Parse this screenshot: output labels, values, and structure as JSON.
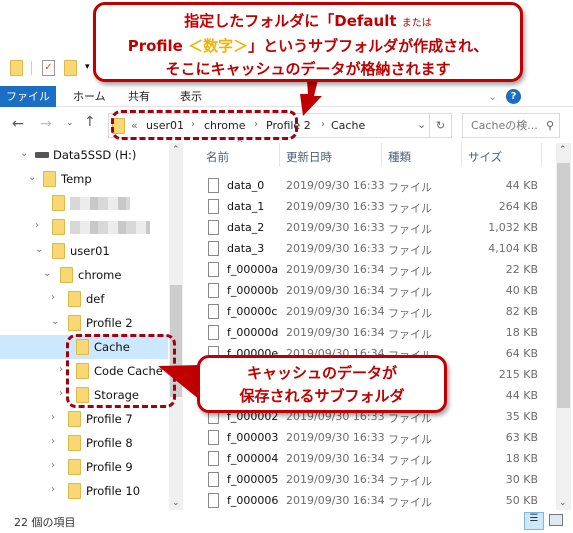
{
  "callouts": {
    "top_line1": "指定したフォルダに「Default",
    "top_line1_small": "または",
    "top_line2_a": "Profile",
    "top_line2_highlight": "＜数字＞",
    "top_line2_b": "」というサブフォルダが作成され、",
    "top_line3": "そこにキャッシュのデータが格納されます",
    "side_line1": "キャッシュのデータが",
    "side_line2": "保存されるサブフォルダ"
  },
  "colors": {
    "accent_red": "#c00000",
    "highlight_yellow": "#f0b400",
    "file_tab_blue": "#1a6fc5",
    "selection": "#cce8ff"
  },
  "ribbon": {
    "tabs": [
      "ファイル",
      "ホーム",
      "共有",
      "表示"
    ]
  },
  "address": {
    "overflow": "«",
    "crumbs": [
      "user01",
      "chrome",
      "Profile 2",
      "Cache"
    ],
    "search_placeholder": "Cacheの検..."
  },
  "tree": [
    {
      "label": "Data5SSD (H:)",
      "level": 0,
      "expanded": true,
      "icon": "drive-icon"
    },
    {
      "label": "Temp",
      "level": 1,
      "expanded": true
    },
    {
      "label": "",
      "level": 2,
      "blurred": true,
      "leaf": true
    },
    {
      "label": "",
      "level": 2,
      "blurred": true
    },
    {
      "label": "user01",
      "level": 2,
      "expanded": true
    },
    {
      "label": "chrome",
      "level": 3,
      "expanded": true
    },
    {
      "label": "def",
      "level": 4
    },
    {
      "label": "Profile 2",
      "level": 4,
      "expanded": true
    },
    {
      "label": "Cache",
      "level": 5,
      "selected": true,
      "leaf": true
    },
    {
      "label": "Code Cache",
      "level": 5
    },
    {
      "label": "Storage",
      "level": 5
    },
    {
      "label": "Profile 7",
      "level": 4
    },
    {
      "label": "Profile 8",
      "level": 4
    },
    {
      "label": "Profile 9",
      "level": 4
    },
    {
      "label": "Profile 10",
      "level": 4
    }
  ],
  "columns": [
    "名前",
    "更新日時",
    "種類",
    "サイズ"
  ],
  "files": [
    {
      "name": "data_0",
      "date": "2019/09/30 16:33",
      "type": "ファイル",
      "size": "44 KB"
    },
    {
      "name": "data_1",
      "date": "2019/09/30 16:33",
      "type": "ファイル",
      "size": "264 KB"
    },
    {
      "name": "data_2",
      "date": "2019/09/30 16:33",
      "type": "ファイル",
      "size": "1,032 KB"
    },
    {
      "name": "data_3",
      "date": "2019/09/30 16:33",
      "type": "ファイル",
      "size": "4,104 KB"
    },
    {
      "name": "f_00000a",
      "date": "2019/09/30 16:34",
      "type": "ファイル",
      "size": "22 KB"
    },
    {
      "name": "f_00000b",
      "date": "2019/09/30 16:34",
      "type": "ファイル",
      "size": "40 KB"
    },
    {
      "name": "f_00000c",
      "date": "2019/09/30 16:34",
      "type": "ファイル",
      "size": "82 KB"
    },
    {
      "name": "f_00000d",
      "date": "2019/09/30 16:34",
      "type": "ファイル",
      "size": "18 KB"
    },
    {
      "name": "f_00000e",
      "date": "2019/09/30 16:34",
      "type": "ファイル",
      "size": "64 KB"
    },
    {
      "name": "",
      "date": "",
      "type": "",
      "size": "215 KB"
    },
    {
      "name": "",
      "date": "",
      "type": "",
      "size": "44 KB"
    },
    {
      "name": "f_000002",
      "date": "2019/09/30 16:33",
      "type": "ファイル",
      "size": "35 KB"
    },
    {
      "name": "f_000003",
      "date": "2019/09/30 16:33",
      "type": "ファイル",
      "size": "63 KB"
    },
    {
      "name": "f_000004",
      "date": "2019/09/30 16:34",
      "type": "ファイル",
      "size": "18 KB"
    },
    {
      "name": "f_000005",
      "date": "2019/09/30 16:34",
      "type": "ファイル",
      "size": "30 KB"
    },
    {
      "name": "f_000006",
      "date": "2019/09/30 16:34",
      "type": "ファイル",
      "size": "50 KB"
    }
  ],
  "status": {
    "item_count": "22 個の項目"
  }
}
